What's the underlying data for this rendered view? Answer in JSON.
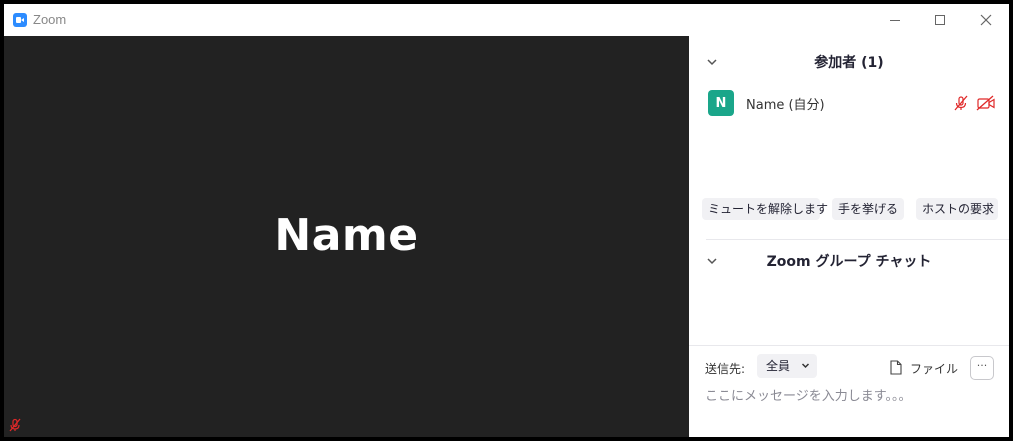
{
  "window": {
    "title": "Zoom"
  },
  "video": {
    "participant_name": "Name",
    "mic_status": "muted"
  },
  "participants": {
    "header": "参加者 (1)",
    "list": [
      {
        "initial": "N",
        "name": "Name (自分)",
        "avatar_color": "#1aa68a",
        "mic": "muted",
        "video": "off"
      }
    ],
    "actions": {
      "unmute": "ミュートを解除します",
      "raise_hand": "手を挙げる",
      "ask_host": "ホストの要求"
    }
  },
  "chat": {
    "header": "Zoom グループ チャット",
    "send_to_label": "送信先:",
    "recipient": "全員",
    "file_label": "ファイル",
    "more_label": "···",
    "message_placeholder": "ここにメッセージを入力します。。。"
  },
  "colors": {
    "video_bg": "#222222",
    "accent": "#2d8cff",
    "muted_red": "#e02828"
  },
  "icons": {
    "app": "zoom-camera-icon",
    "minimize": "minimize-icon",
    "maximize": "maximize-icon",
    "close": "close-icon",
    "collapse": "chevron-down-icon",
    "mic_muted": "microphone-muted-icon",
    "video_off": "video-off-icon",
    "file": "file-icon"
  }
}
